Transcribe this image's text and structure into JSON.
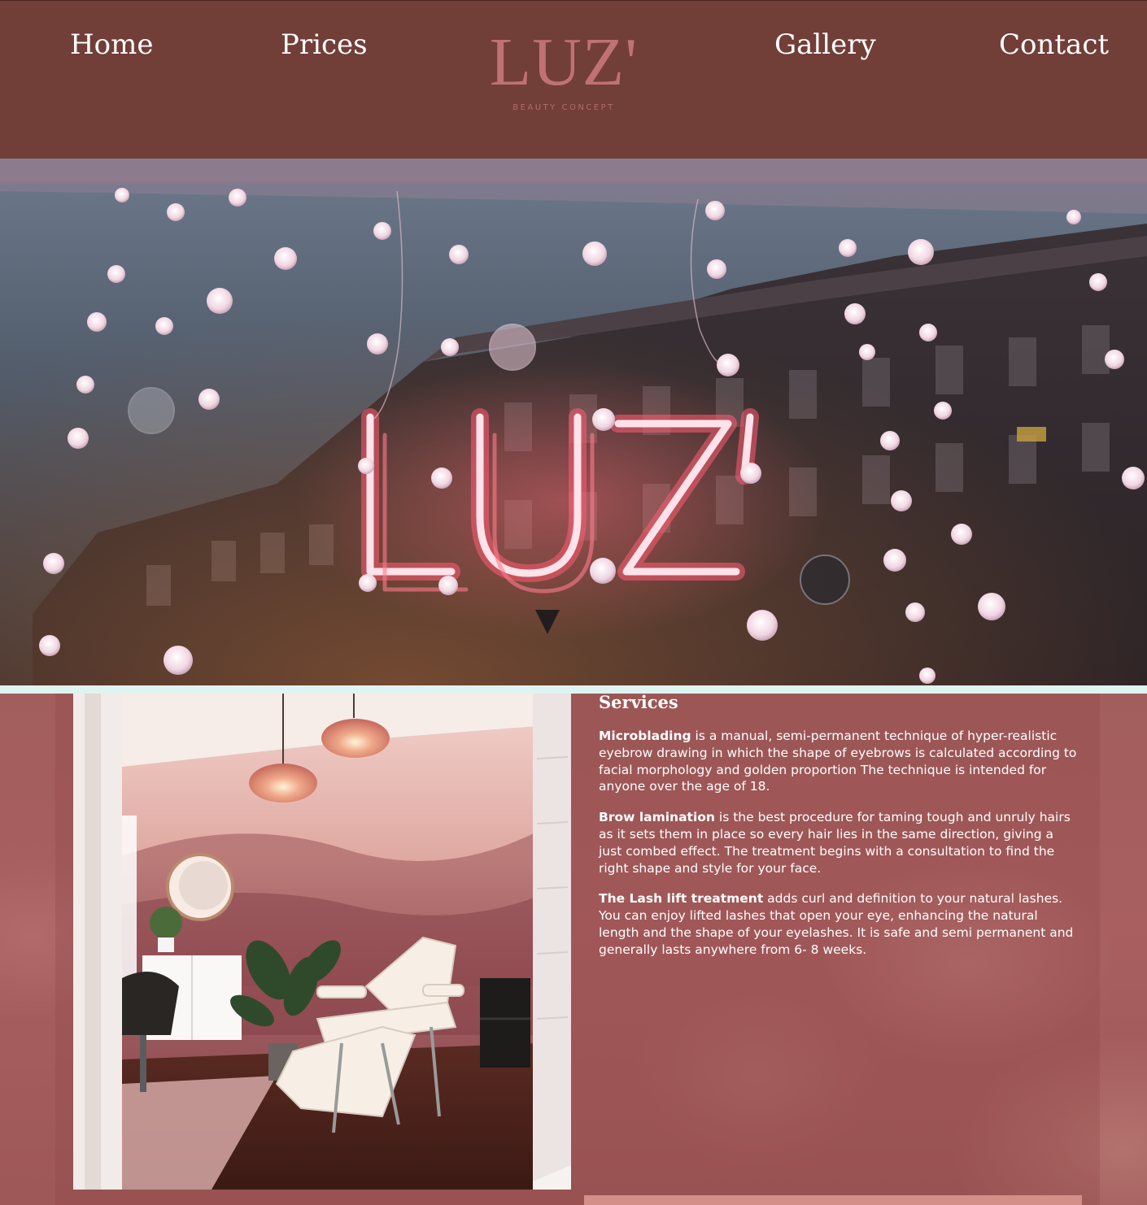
{
  "nav": {
    "home": "Home",
    "prices": "Prices",
    "gallery": "Gallery",
    "contact": "Contact"
  },
  "logo": {
    "word": "LUZ'",
    "tagline": "BEAUTY CONCEPT"
  },
  "hero": {
    "sign_text": "LUZ'"
  },
  "services": {
    "title": "Services",
    "items": [
      {
        "name": "Microblading",
        "text": " is a manual, semi-permanent technique of hyper-realistic eyebrow drawing in which the shape of eyebrows is calculated according to facial morphology and golden proportion The technique is intended for anyone over the age of 18."
      },
      {
        "name": "Brow lamination",
        "text": " is the best procedure for taming tough and unruly hairs as it sets them in place so every hair lies in the same direction, giving a just combed effect. The treatment begins with a consultation to find the right shape and style for your face."
      },
      {
        "name": "The Lash lift treatment",
        "text": " adds curl and definition to your natural lashes. You can enjoy lifted lashes that open your eye, enhancing the natural length and the shape of your eyelashes. It is safe and semi permanent and generally lasts anywhere from 6- 8 weeks."
      }
    ]
  },
  "colors": {
    "header_bg": "#723e38",
    "logo": "#c07272",
    "services_bg": "#a25e5d",
    "neon": "#ff7a8c"
  }
}
